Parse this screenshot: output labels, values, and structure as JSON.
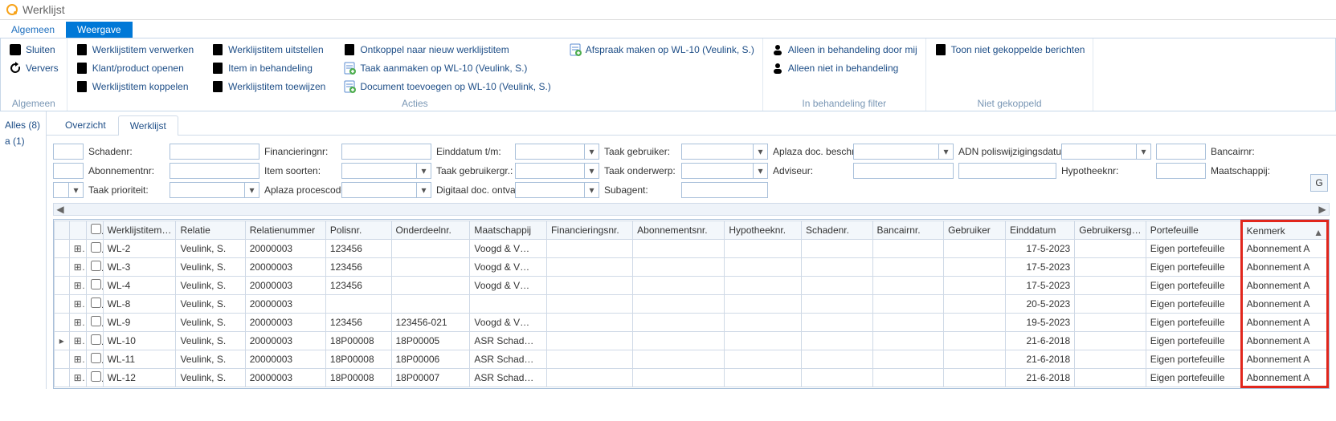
{
  "window": {
    "title": "Werklijst"
  },
  "ribbonTabs": [
    {
      "key": "algemeen",
      "label": "Algemeen",
      "active": false
    },
    {
      "key": "weergave",
      "label": "Weergave",
      "active": true
    }
  ],
  "ribbon": {
    "groups": [
      {
        "name": "Algemeen",
        "items": [
          {
            "key": "sluiten",
            "label": "Sluiten",
            "icon": "close-icon"
          },
          {
            "key": "ververs",
            "label": "Ververs",
            "icon": "refresh-icon"
          }
        ]
      },
      {
        "name": "Acties",
        "items": [
          {
            "key": "wlitem-verwerken",
            "label": "Werklijstitem verwerken",
            "icon": "doc-icon"
          },
          {
            "key": "klant-product-openen",
            "label": "Klant/product openen",
            "icon": "doc-icon"
          },
          {
            "key": "wlitem-koppelen",
            "label": "Werklijstitem koppelen",
            "icon": "doc-icon"
          },
          {
            "key": "wlitem-uitstellen",
            "label": "Werklijstitem uitstellen",
            "icon": "doc-icon"
          },
          {
            "key": "item-in-behandeling",
            "label": "Item in behandeling",
            "icon": "doc-icon"
          },
          {
            "key": "wlitem-toewijzen",
            "label": "Werklijstitem toewijzen",
            "icon": "doc-icon"
          },
          {
            "key": "ontkoppel-nieuw",
            "label": "Ontkoppel naar nieuw werklijstitem",
            "icon": "doc-icon"
          },
          {
            "key": "taak-aanmaken",
            "label": "Taak aanmaken op WL-10 (Veulink,  S.)",
            "icon": "doc-plus-icon"
          },
          {
            "key": "document-toevoegen",
            "label": "Document toevoegen op WL-10 (Veulink,  S.)",
            "icon": "doc-plus-icon"
          },
          {
            "key": "afspraak-maken",
            "label": "Afspraak maken op WL-10 (Veulink,  S.)",
            "icon": "doc-plus-icon"
          }
        ]
      },
      {
        "name": "In behandeling filter",
        "items": [
          {
            "key": "alleen-in-behandeling",
            "label": "Alleen in behandeling door mij",
            "icon": "person-icon"
          },
          {
            "key": "alleen-niet-in-behandeling",
            "label": "Alleen niet in behandeling",
            "icon": "person-icon"
          }
        ]
      },
      {
        "name": "Niet gekoppeld",
        "items": [
          {
            "key": "toon-niet-gekoppeld",
            "label": "Toon niet gekoppelde berichten",
            "icon": "doc-icon"
          }
        ]
      }
    ]
  },
  "sidenav": [
    {
      "key": "alles",
      "label": "Alles (8)"
    },
    {
      "key": "a",
      "label": "a (1)"
    }
  ],
  "viewtabs": [
    {
      "key": "overzicht",
      "label": "Overzicht",
      "active": false
    },
    {
      "key": "werklijst",
      "label": "Werklijst",
      "active": true
    }
  ],
  "filters": {
    "row1": [
      {
        "label": "Schadenr:",
        "type": "text",
        "name": "schadenr"
      },
      {
        "label": "Financieringnr:",
        "type": "text",
        "name": "financieringnr"
      },
      {
        "label": "Einddatum t/m:",
        "type": "combo",
        "name": "einddatum-tm"
      },
      {
        "label": "Taak gebruiker:",
        "type": "combo",
        "name": "taak-gebruiker"
      },
      {
        "label": "Aplaza doc. beschr.:",
        "type": "combo",
        "name": "aplaza-doc-beschr"
      },
      {
        "label": "ADN poliswijzigingsdatum:",
        "type": "combo",
        "name": "adn-poliswijzigingsdatum"
      }
    ],
    "row2": [
      {
        "label": "Bancairnr:",
        "type": "text",
        "name": "bancairnr"
      },
      {
        "label": "Abonnementnr:",
        "type": "text",
        "name": "abonnementnr"
      },
      {
        "label": "Item soorten:",
        "type": "combo",
        "name": "item-soorten"
      },
      {
        "label": "Taak gebruikergr.:",
        "type": "combo",
        "name": "taak-gebruikergr"
      },
      {
        "label": "Taak onderwerp:",
        "type": "combo",
        "name": "taak-onderwerp"
      },
      {
        "label": "Adviseur:",
        "type": "text",
        "name": "adviseur"
      }
    ],
    "row3": [
      {
        "label": "Hypotheeknr:",
        "type": "text",
        "name": "hypotheeknr"
      },
      {
        "label": "Maatschappij:",
        "type": "combo",
        "name": "maatschappij"
      },
      {
        "label": "Taak prioriteit:",
        "type": "combo",
        "name": "taak-prioriteit"
      },
      {
        "label": "Aplaza procescode:",
        "type": "combo",
        "name": "aplaza-procescode"
      },
      {
        "label": "Digitaal doc. ontvangst:",
        "type": "combo",
        "name": "digitaal-doc-ontvangst"
      },
      {
        "label": "Subagent:",
        "type": "text",
        "name": "subagent"
      }
    ]
  },
  "grid": {
    "columns": [
      {
        "key": "wl",
        "label": "Werklijstitemnr."
      },
      {
        "key": "rel",
        "label": "Relatie"
      },
      {
        "key": "reln",
        "label": "Relatienummer"
      },
      {
        "key": "pol",
        "label": "Polisnr."
      },
      {
        "key": "ond",
        "label": "Onderdeelnr."
      },
      {
        "key": "maat",
        "label": "Maatschappij"
      },
      {
        "key": "fin",
        "label": "Financieringsnr."
      },
      {
        "key": "abo",
        "label": "Abonnementsnr."
      },
      {
        "key": "hyp",
        "label": "Hypotheeknr."
      },
      {
        "key": "sch",
        "label": "Schadenr."
      },
      {
        "key": "ban",
        "label": "Bancairnr."
      },
      {
        "key": "geb",
        "label": "Gebruiker"
      },
      {
        "key": "eind",
        "label": "Einddatum"
      },
      {
        "key": "gebg",
        "label": "Gebruikersg…"
      },
      {
        "key": "port",
        "label": "Portefeuille"
      },
      {
        "key": "ken",
        "label": "Kenmerk",
        "sorted": "asc"
      }
    ],
    "rows": [
      {
        "current": false,
        "wl": "WL-2",
        "rel": "Veulink,  S.",
        "reln": "20000003",
        "pol": "123456",
        "ond": "",
        "maat": "Voogd & V…",
        "fin": "",
        "abo": "",
        "hyp": "",
        "sch": "",
        "ban": "",
        "geb": "",
        "eind": "17-5-2023",
        "gebg": "",
        "port": "Eigen portefeuille",
        "ken": "Abonnement A"
      },
      {
        "current": false,
        "wl": "WL-3",
        "rel": "Veulink,  S.",
        "reln": "20000003",
        "pol": "123456",
        "ond": "",
        "maat": "Voogd & V…",
        "fin": "",
        "abo": "",
        "hyp": "",
        "sch": "",
        "ban": "",
        "geb": "",
        "eind": "17-5-2023",
        "gebg": "",
        "port": "Eigen portefeuille",
        "ken": "Abonnement A"
      },
      {
        "current": false,
        "wl": "WL-4",
        "rel": "Veulink,  S.",
        "reln": "20000003",
        "pol": "123456",
        "ond": "",
        "maat": "Voogd & V…",
        "fin": "",
        "abo": "",
        "hyp": "",
        "sch": "",
        "ban": "",
        "geb": "",
        "eind": "17-5-2023",
        "gebg": "",
        "port": "Eigen portefeuille",
        "ken": "Abonnement A"
      },
      {
        "current": false,
        "wl": "WL-8",
        "rel": "Veulink,  S.",
        "reln": "20000003",
        "pol": "",
        "ond": "",
        "maat": "",
        "fin": "",
        "abo": "",
        "hyp": "",
        "sch": "",
        "ban": "",
        "geb": "",
        "eind": "20-5-2023",
        "gebg": "",
        "port": "Eigen portefeuille",
        "ken": "Abonnement A"
      },
      {
        "current": false,
        "wl": "WL-9",
        "rel": "Veulink,  S.",
        "reln": "20000003",
        "pol": "123456",
        "ond": "123456-021",
        "maat": "Voogd & V…",
        "fin": "",
        "abo": "",
        "hyp": "",
        "sch": "",
        "ban": "",
        "geb": "",
        "eind": "19-5-2023",
        "gebg": "",
        "port": "Eigen portefeuille",
        "ken": "Abonnement A"
      },
      {
        "current": true,
        "wl": "WL-10",
        "rel": "Veulink,  S.",
        "reln": "20000003",
        "pol": "18P00008",
        "ond": "18P00005",
        "maat": "ASR Schad…",
        "fin": "",
        "abo": "",
        "hyp": "",
        "sch": "",
        "ban": "",
        "geb": "",
        "eind": "21-6-2018",
        "gebg": "",
        "port": "Eigen portefeuille",
        "ken": "Abonnement A"
      },
      {
        "current": false,
        "wl": "WL-11",
        "rel": "Veulink,  S.",
        "reln": "20000003",
        "pol": "18P00008",
        "ond": "18P00006",
        "maat": "ASR Schad…",
        "fin": "",
        "abo": "",
        "hyp": "",
        "sch": "",
        "ban": "",
        "geb": "",
        "eind": "21-6-2018",
        "gebg": "",
        "port": "Eigen portefeuille",
        "ken": "Abonnement A"
      },
      {
        "current": false,
        "wl": "WL-12",
        "rel": "Veulink,  S.",
        "reln": "20000003",
        "pol": "18P00008",
        "ond": "18P00007",
        "maat": "ASR Schad…",
        "fin": "",
        "abo": "",
        "hyp": "",
        "sch": "",
        "ban": "",
        "geb": "",
        "eind": "21-6-2018",
        "gebg": "",
        "port": "Eigen portefeuille",
        "ken": "Abonnement A"
      }
    ]
  }
}
